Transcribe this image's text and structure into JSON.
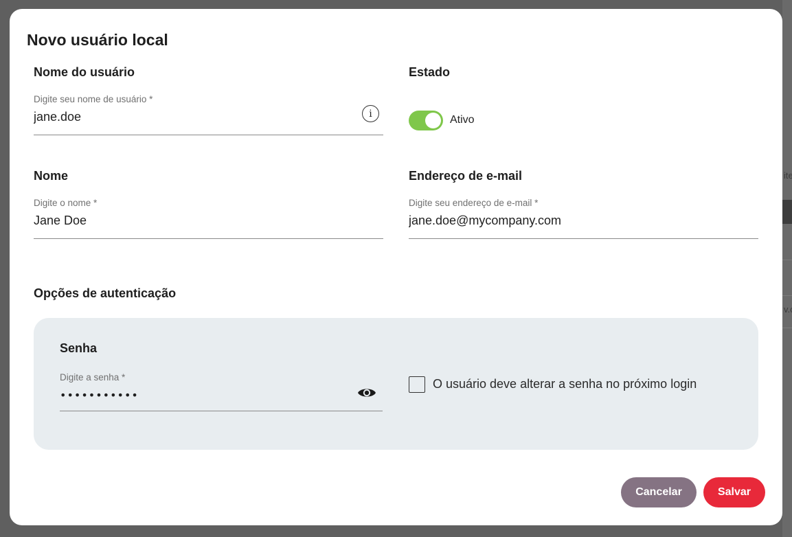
{
  "background": {
    "text_top": "ite",
    "text_bottom": "v.c"
  },
  "modal": {
    "title": "Novo usuário local"
  },
  "username": {
    "section_label": "Nome do usuário",
    "label": "Digite seu nome de usuário *",
    "value": "jane.doe",
    "info_icon": "i"
  },
  "status": {
    "section_label": "Estado",
    "toggle_on": true,
    "toggle_label": "Ativo"
  },
  "name": {
    "section_label": "Nome",
    "label": "Digite o nome *",
    "value": "Jane Doe"
  },
  "email": {
    "section_label": "Endereço de e-mail",
    "label": "Digite seu endereço de e-mail *",
    "value": "jane.doe@mycompany.com"
  },
  "auth": {
    "section_label": "Opções de autenticação",
    "password": {
      "section_label": "Senha",
      "label": "Digite a senha *",
      "value": "•••••••••••"
    },
    "change_on_login": {
      "checked": false,
      "label": "O usuário deve alterar a senha no próximo login"
    }
  },
  "actions": {
    "cancel_label": "Cancelar",
    "save_label": "Salvar"
  },
  "colors": {
    "toggle_on": "#7fc74a",
    "cancel_button": "#857383",
    "save_button": "#e8293a",
    "auth_panel": "#e8edf0"
  },
  "icons": {
    "info": "info-icon",
    "visibility": "eye-icon"
  }
}
